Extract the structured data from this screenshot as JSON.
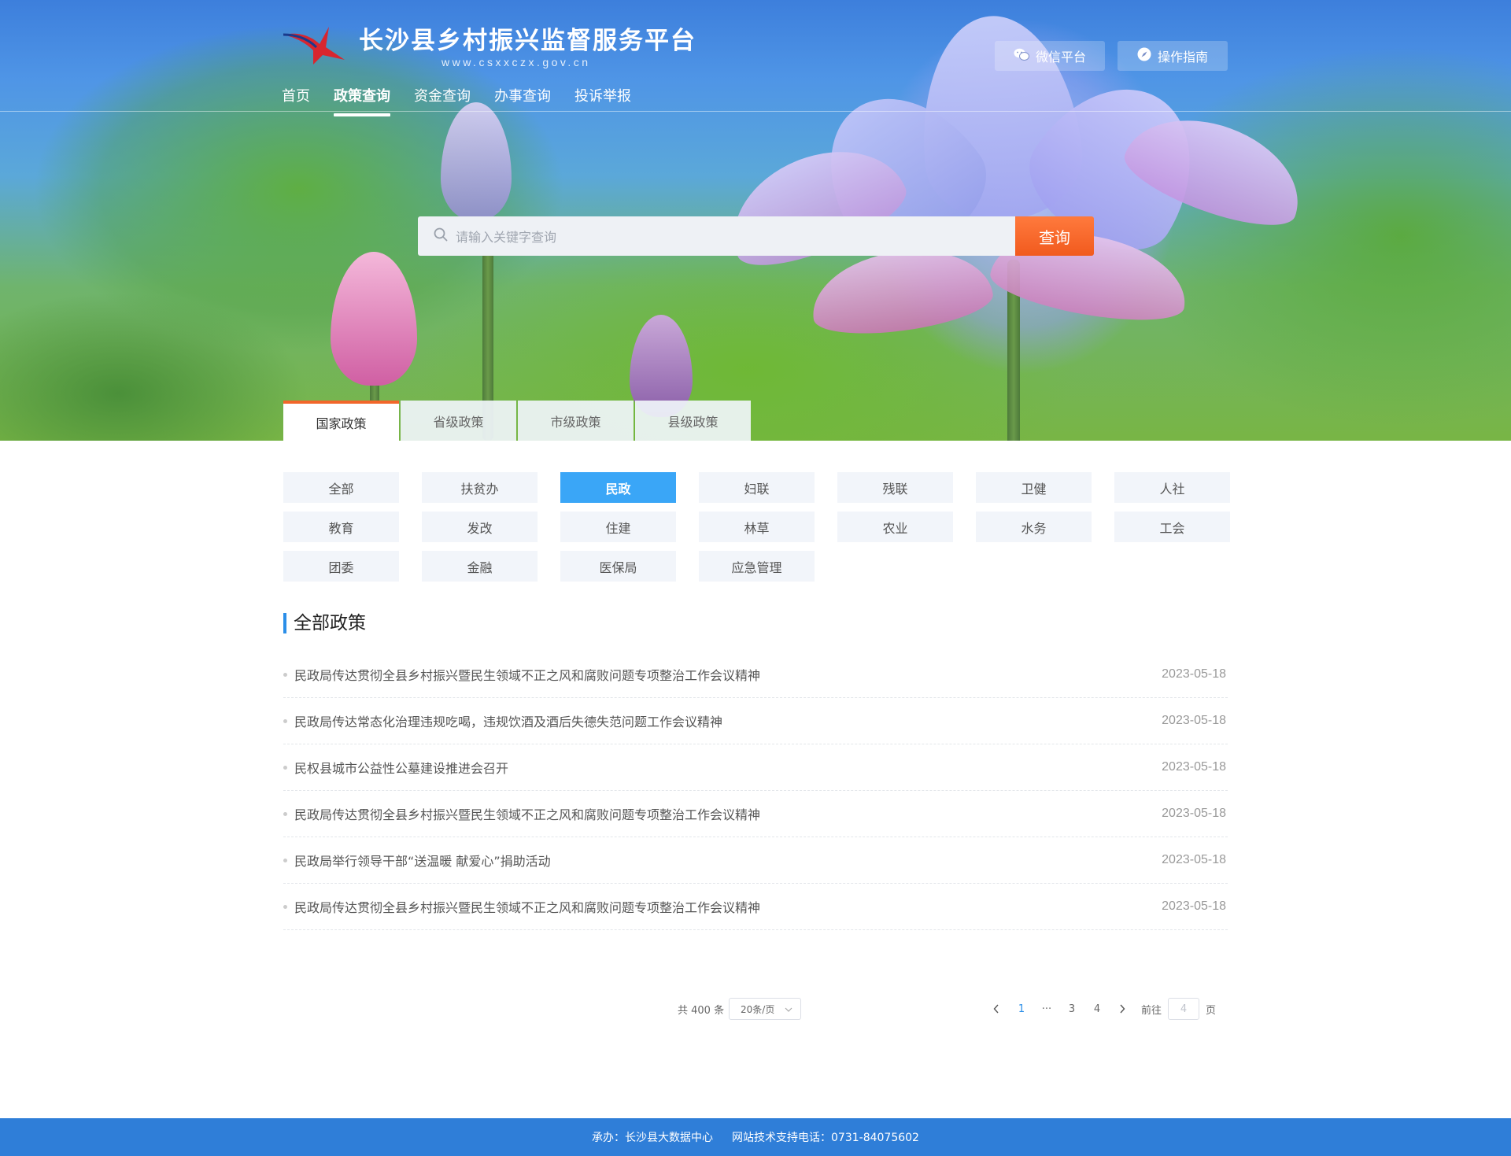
{
  "header": {
    "title": "长沙县乡村振兴监督服务平台",
    "url": "www.csxxczx.gov.cn",
    "buttons": [
      {
        "label": "微信平台",
        "icon": "wechat-icon"
      },
      {
        "label": "操作指南",
        "icon": "compass-icon"
      }
    ],
    "nav": [
      "首页",
      "政策查询",
      "资金查询",
      "办事查询",
      "投诉举报"
    ],
    "nav_active": "政策查询"
  },
  "search": {
    "placeholder": "请输入关键字查询",
    "button_label": "查询"
  },
  "policy_tabs": [
    "国家政策",
    "省级政策",
    "市级政策",
    "县级政策"
  ],
  "policy_tab_active": "国家政策",
  "categories": [
    "全部",
    "扶贫办",
    "民政",
    "妇联",
    "残联",
    "卫健",
    "人社",
    "教育",
    "发改",
    "住建",
    "林草",
    "农业",
    "水务",
    "工会",
    "团委",
    "金融",
    "医保局",
    "应急管理"
  ],
  "category_active": "民政",
  "section_title": "全部政策",
  "items": [
    {
      "title": "民政局传达贯彻全县乡村振兴暨民生领域不正之风和腐败问题专项整治工作会议精神",
      "date": "2023-05-18"
    },
    {
      "title": "民政局传达常态化治理违规吃喝，违规饮酒及酒后失德失范问题工作会议精神",
      "date": "2023-05-18"
    },
    {
      "title": "民权县城市公益性公墓建设推进会召开",
      "date": "2023-05-18"
    },
    {
      "title": "民政局传达贯彻全县乡村振兴暨民生领域不正之风和腐败问题专项整治工作会议精神",
      "date": "2023-05-18"
    },
    {
      "title": "民政局举行领导干部“送温暖 献爱心”捐助活动",
      "date": "2023-05-18"
    },
    {
      "title": "民政局传达贯彻全县乡村振兴暨民生领域不正之风和腐败问题专项整治工作会议精神",
      "date": "2023-05-18"
    }
  ],
  "pagination": {
    "total_text": "共 400 条",
    "page_size": "20条/页",
    "pages": [
      "1",
      "···",
      "3",
      "4"
    ],
    "current": "1",
    "goto_label": "前往",
    "goto_value": "4",
    "page_suffix": "页"
  },
  "footer": {
    "organizer": "承办：长沙县大数据中心",
    "support": "网站技术支持电话：0731-84075602"
  },
  "colors": {
    "accent_orange": "#f15a1e",
    "accent_blue": "#2b8ee8",
    "active_category": "#3aa6f7",
    "footer_bg": "#2f7ed8"
  }
}
